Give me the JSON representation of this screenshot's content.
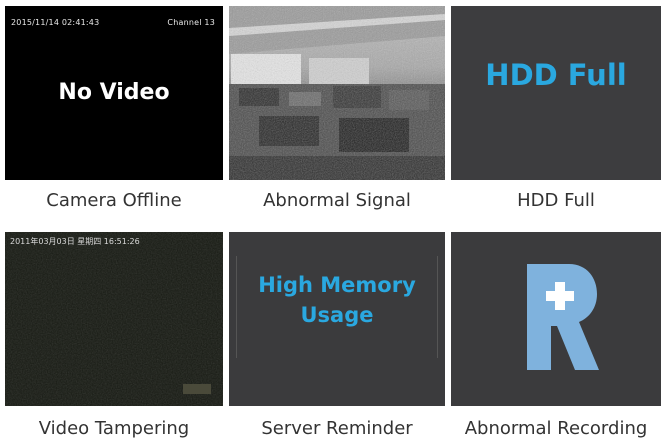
{
  "tiles": [
    {
      "label": "Camera Offline",
      "osd_left": "2015/11/14 02:41:43",
      "osd_right": "Channel 13",
      "center_text": "No Video"
    },
    {
      "label": "Abnormal Signal"
    },
    {
      "label": "HDD Full",
      "center_text": "HDD Full"
    },
    {
      "label": "Video Tampering",
      "osd_left": "2011年03月03日 星期四 16:51:26"
    },
    {
      "label": "Server Reminder",
      "center_line1": "High Memory",
      "center_line2": "Usage"
    },
    {
      "label": "Abnormal Recording"
    }
  ],
  "colors": {
    "accent_blue": "#2aa8e0",
    "logo_blue": "#7fb2dd",
    "tile_gray": "#3b3b3d"
  },
  "icons": {
    "recording": "r-plus-logo-icon"
  }
}
